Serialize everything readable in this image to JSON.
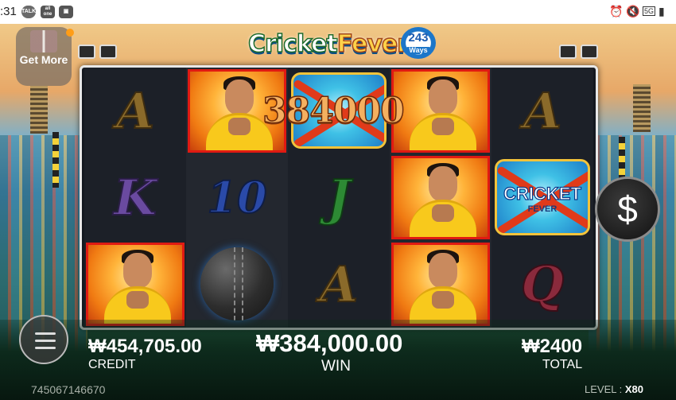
{
  "status_bar": {
    "time": ":31",
    "talk_label": "TALK",
    "allone_label": "all one",
    "signal_label": "5G"
  },
  "game": {
    "logo_title": "Cricket",
    "logo_title_2": "Fever",
    "ways_count": "243",
    "ways_label": "Ways",
    "get_more_label": "Get More",
    "win_overlay": "384000",
    "spin_label": "$"
  },
  "reels": [
    [
      "A",
      "K",
      "player"
    ],
    [
      "player",
      "10",
      "ball"
    ],
    [
      "wild",
      "J",
      "A"
    ],
    [
      "player",
      "player",
      "player"
    ],
    [
      "A",
      "wild",
      "Q"
    ]
  ],
  "wild_symbol": {
    "text": "CRICKET",
    "sub": "FEVER"
  },
  "panel": {
    "credit_value": "₩454,705.00",
    "credit_label": "CREDIT",
    "win_value": "₩384,000.00",
    "win_label": "WIN",
    "total_value": "₩2400",
    "total_label": "TOTAL",
    "game_id": "745067146670",
    "level_label": "LEVEL : ",
    "level_value": "X80"
  },
  "colors": {
    "win_border": "#e01a12",
    "accent_gold": "#f3c33a",
    "panel_bg": "#0d2a1c"
  }
}
